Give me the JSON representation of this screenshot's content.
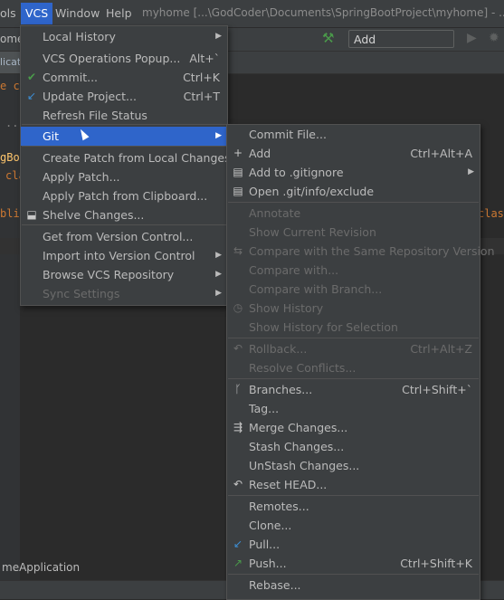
{
  "menubar": {
    "tools_label": "ols",
    "vcs_label": "VCS",
    "window_label": "Window",
    "help_label": "Help",
    "title": "myhome [...\\GodCoder\\Documents\\SpringBootProject\\myhome] - ..."
  },
  "toolbar": {
    "project_label": "ome",
    "add_config_label": "Add Configuration...",
    "hammer_icon": "hammer-icon",
    "run_icon": "run-icon",
    "debug_icon": "debug-icon"
  },
  "editor": {
    "tab_label": "licati",
    "line1": "e co",
    "line2": "...",
    "line3": "gBoo",
    "line4": "cla",
    "line5": "blic",
    "right_fragment": "class",
    "status_text": "meApplication"
  },
  "vcs_menu": {
    "items": [
      {
        "label": "Local History",
        "arrow": "▶"
      },
      {
        "label": "VCS Operations Popup...",
        "shortcut": "Alt+`"
      },
      {
        "label": "Commit...",
        "shortcut": "Ctrl+K",
        "icon": "✔"
      },
      {
        "label": "Update Project...",
        "shortcut": "Ctrl+T",
        "icon": "↙"
      },
      {
        "label": "Refresh File Status"
      },
      {
        "label": "Git",
        "arrow": "▶"
      },
      {
        "label": "Create Patch from Local Changes..."
      },
      {
        "label": "Apply Patch..."
      },
      {
        "label": "Apply Patch from Clipboard..."
      },
      {
        "label": "Shelve Changes...",
        "icon": "⬓"
      },
      {
        "label": "Get from Version Control..."
      },
      {
        "label": "Import into Version Control",
        "arrow": "▶"
      },
      {
        "label": "Browse VCS Repository",
        "arrow": "▶"
      },
      {
        "label": "Sync Settings",
        "arrow": "▶"
      }
    ]
  },
  "git_menu": {
    "items": [
      {
        "label": "Commit File..."
      },
      {
        "label": "Add",
        "shortcut": "Ctrl+Alt+A",
        "icon": "+"
      },
      {
        "label": "Add to .gitignore",
        "arrow": "▶",
        "icon": "▤"
      },
      {
        "label": "Open .git/info/exclude",
        "icon": "▤"
      },
      {
        "label": "Annotate"
      },
      {
        "label": "Show Current Revision"
      },
      {
        "label": "Compare with the Same Repository Version",
        "icon": "⇆"
      },
      {
        "label": "Compare with..."
      },
      {
        "label": "Compare with Branch..."
      },
      {
        "label": "Show History",
        "icon": "◷"
      },
      {
        "label": "Show History for Selection"
      },
      {
        "label": "Rollback...",
        "shortcut": "Ctrl+Alt+Z",
        "icon": "↶"
      },
      {
        "label": "Resolve Conflicts..."
      },
      {
        "label": "Branches...",
        "shortcut": "Ctrl+Shift+`",
        "icon": "ᚴ"
      },
      {
        "label": "Tag..."
      },
      {
        "label": "Merge Changes...",
        "icon": "⇶"
      },
      {
        "label": "Stash Changes..."
      },
      {
        "label": "UnStash Changes..."
      },
      {
        "label": "Reset HEAD...",
        "icon": "↶"
      },
      {
        "label": "Remotes..."
      },
      {
        "label": "Clone..."
      },
      {
        "label": "Pull...",
        "icon": "↙"
      },
      {
        "label": "Push...",
        "shortcut": "Ctrl+Shift+K",
        "icon": "↗"
      },
      {
        "label": "Rebase..."
      }
    ]
  },
  "colors": {
    "menu_bg": "#3c3f41",
    "selection": "#2f65ca",
    "editor_bg": "#2b2b2b",
    "disabled_text": "#6b6b6b",
    "commit_check": "#4a9a4a",
    "update_arrow": "#3d8fd6"
  }
}
